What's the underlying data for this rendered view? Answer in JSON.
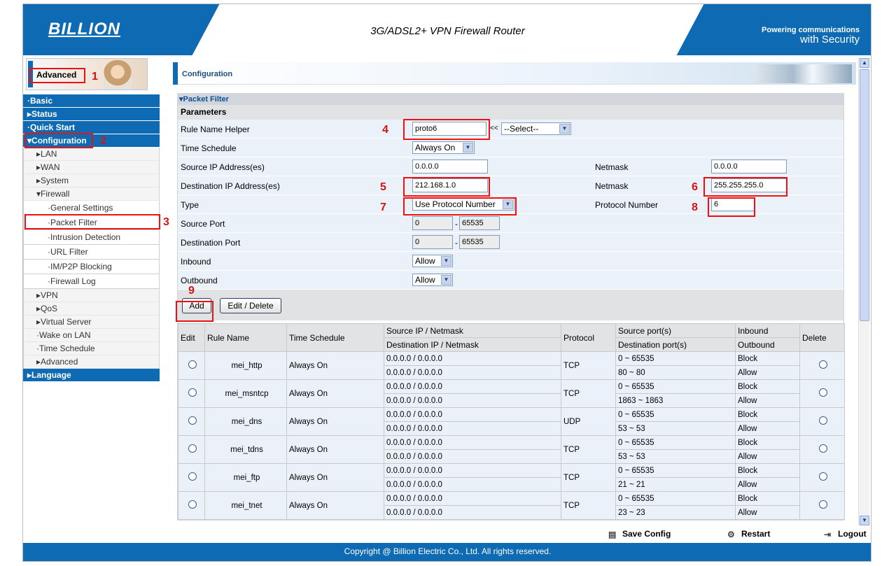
{
  "header": {
    "logo": "BILLION",
    "title": "3G/ADSL2+ VPN Firewall Router",
    "tagline_1": "Powering communications",
    "tagline_2": "with Security"
  },
  "sidebar": {
    "section_label": "Advanced",
    "items": [
      {
        "label": "Basic",
        "level": "top",
        "marker": "·"
      },
      {
        "label": "Status",
        "level": "top",
        "marker": "▸"
      },
      {
        "label": "Quick Start",
        "level": "top",
        "marker": "·"
      },
      {
        "label": "Configuration",
        "level": "top",
        "marker": "▾"
      },
      {
        "label": "LAN",
        "level": "sub",
        "marker": "▸"
      },
      {
        "label": "WAN",
        "level": "sub",
        "marker": "▸"
      },
      {
        "label": "System",
        "level": "sub",
        "marker": "▸"
      },
      {
        "label": "Firewall",
        "level": "sub",
        "marker": "▾"
      },
      {
        "label": "General Settings",
        "level": "sub2",
        "marker": "·"
      },
      {
        "label": "Packet Filter",
        "level": "sub2",
        "marker": "·"
      },
      {
        "label": "Intrusion Detection",
        "level": "sub2",
        "marker": "·"
      },
      {
        "label": "URL Filter",
        "level": "sub2",
        "marker": "·"
      },
      {
        "label": "IM/P2P Blocking",
        "level": "sub2",
        "marker": "·"
      },
      {
        "label": "Firewall Log",
        "level": "sub2",
        "marker": "·"
      },
      {
        "label": "VPN",
        "level": "sub",
        "marker": "▸"
      },
      {
        "label": "QoS",
        "level": "sub",
        "marker": "▸"
      },
      {
        "label": "Virtual Server",
        "level": "sub",
        "marker": "▸"
      },
      {
        "label": "Wake on LAN",
        "level": "sub",
        "marker": "·"
      },
      {
        "label": "Time Schedule",
        "level": "sub",
        "marker": "·"
      },
      {
        "label": "Advanced",
        "level": "sub",
        "marker": "▸"
      },
      {
        "label": "Language",
        "level": "top",
        "marker": "▸"
      }
    ]
  },
  "annotations": [
    "1",
    "2",
    "3",
    "4",
    "5",
    "6",
    "7",
    "8",
    "9"
  ],
  "page": {
    "title": "Configuration",
    "section": "▾Packet Filter",
    "params_label": "Parameters"
  },
  "form": {
    "rule_name_label": "Rule Name  Helper",
    "rule_name_value": "proto6",
    "helper_sep": "<<",
    "helper_select": "--Select--",
    "time_schedule_label": "Time Schedule",
    "time_schedule_value": "Always On",
    "src_ip_label": "Source IP Address(es)",
    "src_ip_value": "0.0.0.0",
    "src_netmask_label": "Netmask",
    "src_netmask_value": "0.0.0.0",
    "dst_ip_label": "Destination IP Address(es)",
    "dst_ip_value": "212.168.1.0",
    "dst_netmask_label": "Netmask",
    "dst_netmask_value": "255.255.255.0",
    "type_label": "Type",
    "type_value": "Use Protocol Number",
    "protocol_number_label": "Protocol Number",
    "protocol_number_value": "6",
    "src_port_label": "Source Port",
    "src_port_from": "0",
    "src_port_to": "65535",
    "dst_port_label": "Destination Port",
    "dst_port_from": "0",
    "dst_port_to": "65535",
    "port_sep": "-",
    "inbound_label": "Inbound",
    "inbound_value": "Allow",
    "outbound_label": "Outbound",
    "outbound_value": "Allow",
    "add_label": "Add",
    "edit_delete_label": "Edit / Delete"
  },
  "table": {
    "headers": {
      "edit": "Edit",
      "rule_name": "Rule Name",
      "time_schedule": "Time Schedule",
      "src": "Source IP / Netmask",
      "dst": "Destination IP / Netmask",
      "protocol": "Protocol",
      "src_port": "Source port(s)",
      "dst_port": "Destination port(s)",
      "inbound": "Inbound",
      "outbound": "Outbound",
      "delete": "Delete"
    },
    "rows": [
      {
        "name": "mei_http",
        "schedule": "Always On",
        "src": "0.0.0.0 / 0.0.0.0",
        "dst": "0.0.0.0 / 0.0.0.0",
        "protocol": "TCP",
        "src_port": "0 ~ 65535",
        "dst_port": "80 ~ 80",
        "inbound": "Block",
        "outbound": "Allow"
      },
      {
        "name": "mei_msntcp",
        "schedule": "Always On",
        "src": "0.0.0.0 / 0.0.0.0",
        "dst": "0.0.0.0 / 0.0.0.0",
        "protocol": "TCP",
        "src_port": "0 ~ 65535",
        "dst_port": "1863 ~ 1863",
        "inbound": "Block",
        "outbound": "Allow"
      },
      {
        "name": "mei_dns",
        "schedule": "Always On",
        "src": "0.0.0.0 / 0.0.0.0",
        "dst": "0.0.0.0 / 0.0.0.0",
        "protocol": "UDP",
        "src_port": "0 ~ 65535",
        "dst_port": "53 ~ 53",
        "inbound": "Block",
        "outbound": "Allow"
      },
      {
        "name": "mei_tdns",
        "schedule": "Always On",
        "src": "0.0.0.0 / 0.0.0.0",
        "dst": "0.0.0.0 / 0.0.0.0",
        "protocol": "TCP",
        "src_port": "0 ~ 65535",
        "dst_port": "53 ~ 53",
        "inbound": "Block",
        "outbound": "Allow"
      },
      {
        "name": "mei_ftp",
        "schedule": "Always On",
        "src": "0.0.0.0 / 0.0.0.0",
        "dst": "0.0.0.0 / 0.0.0.0",
        "protocol": "TCP",
        "src_port": "0 ~ 65535",
        "dst_port": "21 ~ 21",
        "inbound": "Block",
        "outbound": "Allow"
      },
      {
        "name": "mei_tnet",
        "schedule": "Always On",
        "src": "0.0.0.0 / 0.0.0.0",
        "dst": "0.0.0.0 / 0.0.0.0",
        "protocol": "TCP",
        "src_port": "0 ~ 65535",
        "dst_port": "23 ~ 23",
        "inbound": "Block",
        "outbound": "Allow"
      }
    ]
  },
  "actions": {
    "save": "Save Config",
    "restart": "Restart",
    "logout": "Logout"
  },
  "footer": {
    "copyright": "Copyright @ Billion Electric Co., Ltd. All rights reserved."
  },
  "colors": {
    "brand_blue": "#0e6bb3",
    "highlight_red": "#e11111",
    "row_bg": "#eaf1f8"
  }
}
